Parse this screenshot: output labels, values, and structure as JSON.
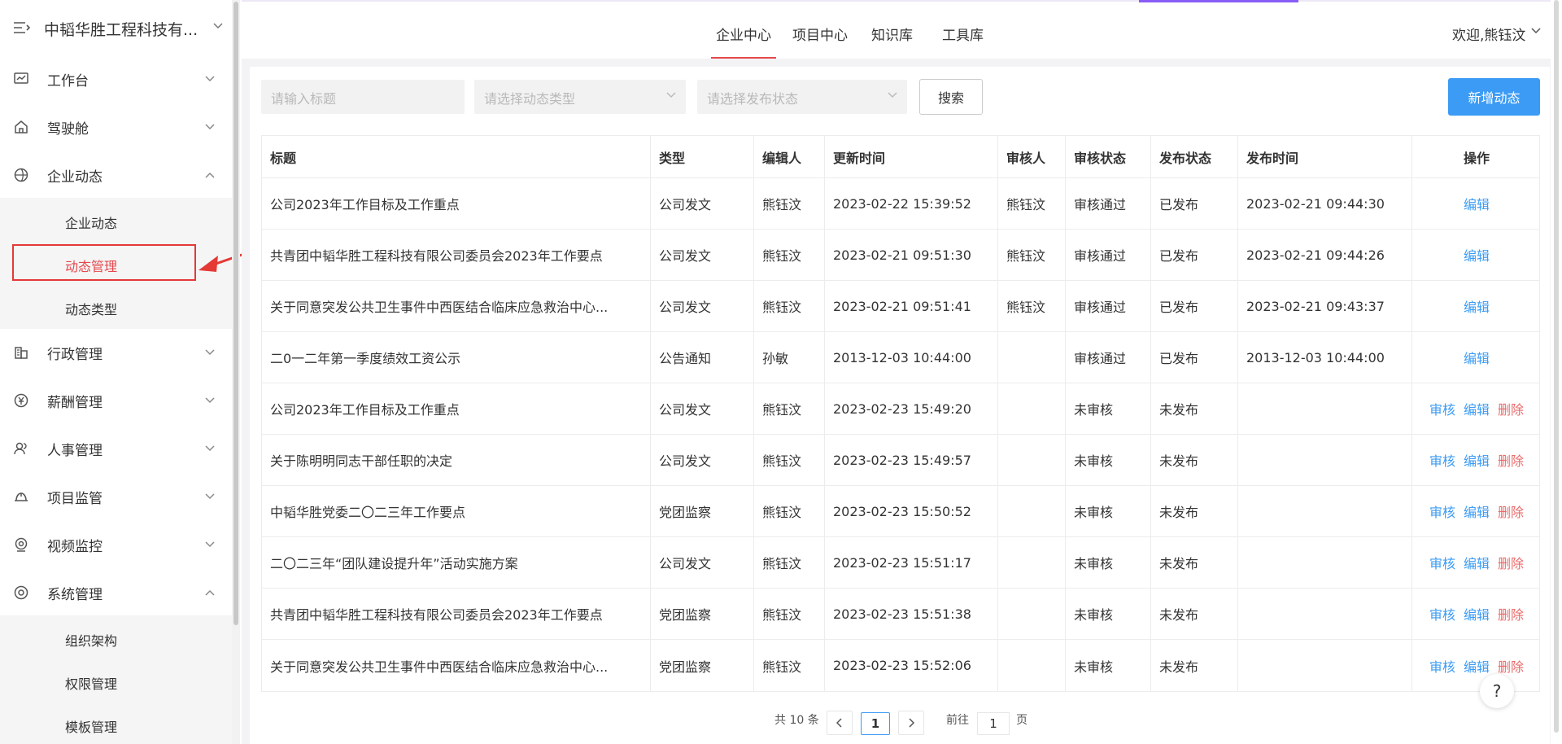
{
  "sidebar": {
    "company": "中韬华胜工程科技有...",
    "items": [
      {
        "label": "工作台",
        "icon": "dashboard-icon"
      },
      {
        "label": "驾驶舱",
        "icon": "home-icon"
      },
      {
        "label": "企业动态",
        "icon": "globe-icon",
        "expanded": true
      },
      {
        "label": "行政管理",
        "icon": "building-icon"
      },
      {
        "label": "薪酬管理",
        "icon": "salary-icon"
      },
      {
        "label": "人事管理",
        "icon": "people-icon"
      },
      {
        "label": "项目监管",
        "icon": "helmet-icon"
      },
      {
        "label": "视频监控",
        "icon": "camera-icon"
      },
      {
        "label": "系统管理",
        "icon": "settings-icon",
        "expanded": true
      }
    ],
    "news_sub": [
      "企业动态",
      "动态管理",
      "动态类型"
    ],
    "active_sub": "动态管理",
    "system_sub": [
      "组织架构",
      "权限管理",
      "模板管理"
    ]
  },
  "topnav": {
    "tabs": [
      "企业中心",
      "项目中心",
      "知识库",
      "工具库"
    ],
    "active": "企业中心",
    "welcome": "欢迎,熊钰汶"
  },
  "filters": {
    "title_placeholder": "请输入标题",
    "type_placeholder": "请选择动态类型",
    "status_placeholder": "请选择发布状态",
    "search_label": "搜索",
    "new_label": "新增动态"
  },
  "table": {
    "headers": [
      "标题",
      "类型",
      "编辑人",
      "更新时间",
      "审核人",
      "审核状态",
      "发布状态",
      "发布时间",
      "操作"
    ],
    "actions": {
      "review": "审核",
      "edit": "编辑",
      "delete": "删除"
    },
    "rows": [
      {
        "title": "公司2023年工作目标及工作重点",
        "type": "公司发文",
        "editor": "熊钰汶",
        "updated": "2023-02-22 15:39:52",
        "reviewer": "熊钰汶",
        "review_status": "审核通过",
        "publish_status": "已发布",
        "publish_time": "2023-02-21 09:44:30"
      },
      {
        "title": "共青团中韬华胜工程科技有限公司委员会2023年工作要点",
        "type": "公司发文",
        "editor": "熊钰汶",
        "updated": "2023-02-21 09:51:30",
        "reviewer": "熊钰汶",
        "review_status": "审核通过",
        "publish_status": "已发布",
        "publish_time": "2023-02-21 09:44:26"
      },
      {
        "title": "关于同意突发公共卫生事件中西医结合临床应急救治中心...",
        "type": "公司发文",
        "editor": "熊钰汶",
        "updated": "2023-02-21 09:51:41",
        "reviewer": "熊钰汶",
        "review_status": "审核通过",
        "publish_status": "已发布",
        "publish_time": "2023-02-21 09:43:37"
      },
      {
        "title": "二0一二年第一季度绩效工资公示",
        "type": "公告通知",
        "editor": "孙敏",
        "updated": "2013-12-03 10:44:00",
        "reviewer": "",
        "review_status": "审核通过",
        "publish_status": "已发布",
        "publish_time": "2013-12-03 10:44:00"
      },
      {
        "title": "公司2023年工作目标及工作重点",
        "type": "公司发文",
        "editor": "熊钰汶",
        "updated": "2023-02-23 15:49:20",
        "reviewer": "",
        "review_status": "未审核",
        "publish_status": "未发布",
        "publish_time": ""
      },
      {
        "title": "关于陈明明同志干部任职的决定",
        "type": "公司发文",
        "editor": "熊钰汶",
        "updated": "2023-02-23 15:49:57",
        "reviewer": "",
        "review_status": "未审核",
        "publish_status": "未发布",
        "publish_time": ""
      },
      {
        "title": "中韬华胜党委二〇二三年工作要点",
        "type": "党团监察",
        "editor": "熊钰汶",
        "updated": "2023-02-23 15:50:52",
        "reviewer": "",
        "review_status": "未审核",
        "publish_status": "未发布",
        "publish_time": ""
      },
      {
        "title": "二〇二三年“团队建设提升年”活动实施方案",
        "type": "公司发文",
        "editor": "熊钰汶",
        "updated": "2023-02-23 15:51:17",
        "reviewer": "",
        "review_status": "未审核",
        "publish_status": "未发布",
        "publish_time": ""
      },
      {
        "title": "共青团中韬华胜工程科技有限公司委员会2023年工作要点",
        "type": "党团监察",
        "editor": "熊钰汶",
        "updated": "2023-02-23 15:51:38",
        "reviewer": "",
        "review_status": "未审核",
        "publish_status": "未发布",
        "publish_time": ""
      },
      {
        "title": "关于同意突发公共卫生事件中西医结合临床应急救治中心...",
        "type": "党团监察",
        "editor": "熊钰汶",
        "updated": "2023-02-23 15:52:06",
        "reviewer": "",
        "review_status": "未审核",
        "publish_status": "未发布",
        "publish_time": ""
      }
    ]
  },
  "pagination": {
    "total_text": "共 10 条",
    "current_page": "1",
    "goto_prefix": "前往",
    "goto_value": "1",
    "goto_suffix": "页"
  },
  "help_label": "?",
  "colors": {
    "accent_blue": "#3b9bf5",
    "accent_red": "#e5484d",
    "delete_red": "#e96a6a",
    "annotation_red": "#e53935"
  }
}
